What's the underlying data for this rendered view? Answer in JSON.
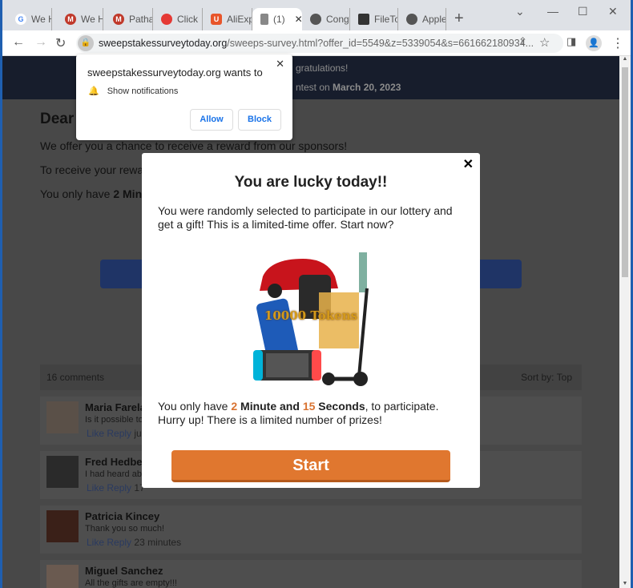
{
  "browser": {
    "tabs": [
      {
        "label": "We H",
        "icon": "google-icon",
        "color": "#4285f4"
      },
      {
        "label": "We H",
        "icon": "m-icon",
        "color": "#c0392b"
      },
      {
        "label": "Patha",
        "icon": "m-icon",
        "color": "#c0392b"
      },
      {
        "label": "Click",
        "icon": "red-circle-icon",
        "color": "#e53935"
      },
      {
        "label": "AliExp",
        "icon": "aliexpress-icon",
        "color": "#e8552a"
      },
      {
        "label": "(1)",
        "icon": "document-icon",
        "color": "#666666",
        "active": true
      },
      {
        "label": "Cong",
        "icon": "globe-icon",
        "color": "#555555"
      },
      {
        "label": "FileTo",
        "icon": "file-icon",
        "color": "#333333"
      },
      {
        "label": "Apple",
        "icon": "globe-icon",
        "color": "#555555"
      }
    ],
    "url_domain": "sweepstakessurveytoday.org",
    "url_path": "/sweeps-survey.html?offer_id=5549&z=5339054&s=661662180934..."
  },
  "notification": {
    "title": "sweepstakessurveytoday.org wants to",
    "permission": "Show notifications",
    "allow": "Allow",
    "block": "Block"
  },
  "page": {
    "header_line1": "gratulations!",
    "header_line2_prefix": "ntest on ",
    "header_date": "March 20, 2023",
    "dear": "Dear",
    "p1": "We offer you a chance to receive a reward from our sponsors!",
    "p2": "To receive your rewa",
    "p3_prefix": "You only have ",
    "p3_bold": "2 Minu",
    "comments_count": "16 comments",
    "sort_by": "Sort by:",
    "sort_value": "Top",
    "comments": [
      {
        "name": "Maria Farela",
        "text": "Is it possible to",
        "like": "Like",
        "reply": "Reply",
        "time": "ju"
      },
      {
        "name": "Fred Hedbe",
        "text": "I had heard ab",
        "like": "Like",
        "reply": "Reply",
        "time": "17"
      },
      {
        "name": "Patricia Kincey",
        "text": "Thank you so much!",
        "like": "Like",
        "reply": "Reply",
        "time": "23 minutes"
      },
      {
        "name": "Miguel Sanchez",
        "text": "All the gifts are empty!!!",
        "like": "Like",
        "reply": "Reply",
        "time": ""
      }
    ]
  },
  "modal": {
    "title": "You are lucky today!!",
    "intro": "You were randomly selected to participate in our lottery and get a gift! This is a limited-time offer. Start now?",
    "prize_tokens": "10000 Tokens",
    "t1": "You only have ",
    "minutes": "2",
    "t2": " Minute and ",
    "seconds": "15",
    "t3": " Seconds",
    "t4": ", to participate.",
    "hurry": "Hurry up! There is a limited number of prizes!",
    "start": "Start",
    "accent": "#e0772f"
  }
}
